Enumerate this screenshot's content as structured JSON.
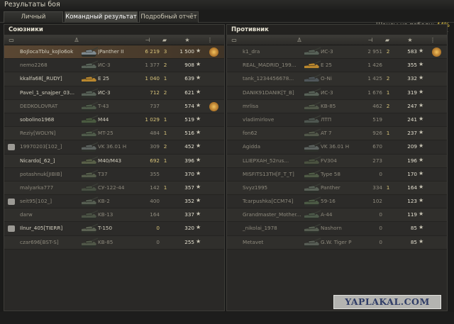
{
  "window_title": "Результаты боя",
  "tabs": [
    {
      "label": "Личный результат",
      "active": false
    },
    {
      "label": "Командный результат",
      "active": true
    },
    {
      "label": "Подробный отчёт",
      "active": false
    }
  ],
  "win_chance": {
    "label": "Шансы на победу:",
    "value": "44%"
  },
  "colors": {
    "accent": "#e2c241",
    "highlight_row": "#5a4733",
    "background": "#2a2927"
  },
  "allies": {
    "title": "Союзники",
    "players": [
      {
        "name": "BoJlocaTblu_koJlo6ok",
        "tank": "JPanther II",
        "damage": "6 219",
        "kills": "3",
        "xp": "1 500",
        "alive": true,
        "me": true,
        "medal": true,
        "badge": false,
        "tank_color": "#7f8a8f"
      },
      {
        "name": "nemo2268",
        "tank": "ИС-3",
        "damage": "1 377",
        "kills": "2",
        "xp": "908",
        "alive": false,
        "me": false,
        "medal": false,
        "badge": false,
        "tank_color": "#586258"
      },
      {
        "name": "kkalfa68[_RUDY]",
        "tank": "E 25",
        "damage": "1 040",
        "kills": "1",
        "xp": "639",
        "alive": true,
        "me": false,
        "medal": false,
        "badge": false,
        "tank_color": "#b9872e"
      },
      {
        "name": "Pavel_1_snajper_03...",
        "tank": "ИС-3",
        "damage": "712",
        "kills": "2",
        "xp": "621",
        "alive": true,
        "me": false,
        "medal": false,
        "badge": false,
        "tank_color": "#586258"
      },
      {
        "name": "DEDKOLOVRAT",
        "tank": "T-43",
        "damage": "737",
        "kills": "",
        "xp": "574",
        "alive": false,
        "me": false,
        "medal": true,
        "badge": false,
        "tank_color": "#4d5948"
      },
      {
        "name": "sobolino1968",
        "tank": "M44",
        "damage": "1 029",
        "kills": "1",
        "xp": "519",
        "alive": true,
        "me": false,
        "medal": false,
        "badge": false,
        "tank_color": "#4a5a40"
      },
      {
        "name": "Reziy[WOLYN]",
        "tank": "MT-25",
        "damage": "484",
        "kills": "1",
        "xp": "516",
        "alive": false,
        "me": false,
        "medal": false,
        "badge": false,
        "tank_color": "#4f5b4a"
      },
      {
        "name": "19970203[102_]",
        "tank": "VK 36.01 H",
        "damage": "309",
        "kills": "2",
        "xp": "452",
        "alive": false,
        "me": false,
        "medal": false,
        "badge": true,
        "tank_color": "#5d6360"
      },
      {
        "name": "Nicardo[_62_]",
        "tank": "M40/M43",
        "damage": "692",
        "kills": "1",
        "xp": "396",
        "alive": true,
        "me": false,
        "medal": false,
        "badge": false,
        "tank_color": "#596048"
      },
      {
        "name": "potashnuk[JIBIB]",
        "tank": "T37",
        "damage": "355",
        "kills": "",
        "xp": "370",
        "alive": false,
        "me": false,
        "medal": false,
        "badge": false,
        "tank_color": "#545c4a"
      },
      {
        "name": "malyarka777",
        "tank": "СУ-122-44",
        "damage": "142",
        "kills": "1",
        "xp": "357",
        "alive": false,
        "me": false,
        "medal": false,
        "badge": false,
        "tank_color": "#485042"
      },
      {
        "name": "seit95[102_]",
        "tank": "KB-2",
        "damage": "400",
        "kills": "",
        "xp": "352",
        "alive": false,
        "me": false,
        "medal": false,
        "badge": true,
        "tank_color": "#565e52"
      },
      {
        "name": "darw",
        "tank": "KB-13",
        "damage": "164",
        "kills": "",
        "xp": "337",
        "alive": false,
        "me": false,
        "medal": false,
        "badge": false,
        "tank_color": "#4c5446"
      },
      {
        "name": "Ilnur_405[TIERR]",
        "tank": "T-150",
        "damage": "0",
        "kills": "",
        "xp": "320",
        "alive": true,
        "me": false,
        "medal": false,
        "badge": true,
        "tank_color": "#5b6152"
      },
      {
        "name": "czar696[BST-S]",
        "tank": "KB-85",
        "damage": "0",
        "kills": "",
        "xp": "255",
        "alive": false,
        "me": false,
        "medal": false,
        "badge": false,
        "tank_color": "#505748"
      }
    ]
  },
  "enemies": {
    "title": "Противник",
    "players": [
      {
        "name": "k1_dra",
        "tank": "ИС-3",
        "damage": "2 951",
        "kills": "2",
        "xp": "583",
        "alive": false,
        "me": false,
        "medal": true,
        "badge": false,
        "tank_color": "#586258"
      },
      {
        "name": "REAL_MADRID_199...",
        "tank": "E 25",
        "damage": "1 426",
        "kills": "",
        "xp": "355",
        "alive": false,
        "me": false,
        "medal": false,
        "badge": false,
        "tank_color": "#b9872e"
      },
      {
        "name": "tank_1234456678...",
        "tank": "O-Ni",
        "damage": "1 425",
        "kills": "2",
        "xp": "332",
        "alive": false,
        "me": false,
        "medal": false,
        "badge": false,
        "tank_color": "#4f565a"
      },
      {
        "name": "DANIK91DANIK[T_B]",
        "tank": "ИС-3",
        "damage": "1 676",
        "kills": "1",
        "xp": "319",
        "alive": false,
        "me": false,
        "medal": false,
        "badge": false,
        "tank_color": "#586258"
      },
      {
        "name": "mrlisa",
        "tank": "KB-85",
        "damage": "462",
        "kills": "2",
        "xp": "247",
        "alive": false,
        "me": false,
        "medal": false,
        "badge": false,
        "tank_color": "#505748"
      },
      {
        "name": "vladimirlove",
        "tank": "ЛТП",
        "damage": "519",
        "kills": "",
        "xp": "241",
        "alive": false,
        "me": false,
        "medal": false,
        "badge": false,
        "tank_color": "#4e5650"
      },
      {
        "name": "fon62",
        "tank": "AT 7",
        "damage": "926",
        "kills": "1",
        "xp": "237",
        "alive": false,
        "me": false,
        "medal": false,
        "badge": false,
        "tank_color": "#515749"
      },
      {
        "name": "Agidda",
        "tank": "VK 36.01 H",
        "damage": "670",
        "kills": "",
        "xp": "209",
        "alive": false,
        "me": false,
        "medal": false,
        "badge": false,
        "tank_color": "#5d6360"
      },
      {
        "name": "LLIEPXAH_52rus...",
        "tank": "FV304",
        "damage": "273",
        "kills": "",
        "xp": "196",
        "alive": false,
        "me": false,
        "medal": false,
        "badge": false,
        "tank_color": "#4a5240"
      },
      {
        "name": "MISFITS13TH[F_T_T]",
        "tank": "Type 58",
        "damage": "0",
        "kills": "",
        "xp": "170",
        "alive": false,
        "me": false,
        "medal": false,
        "badge": false,
        "tank_color": "#4f5b46"
      },
      {
        "name": "Svyz1995",
        "tank": "Panther",
        "damage": "334",
        "kills": "1",
        "xp": "164",
        "alive": false,
        "me": false,
        "medal": false,
        "badge": false,
        "tank_color": "#596157"
      },
      {
        "name": "Tcarpushka[CCM74]",
        "tank": "59-16",
        "damage": "102",
        "kills": "",
        "xp": "123",
        "alive": false,
        "me": false,
        "medal": false,
        "badge": false,
        "tank_color": "#4c5a45"
      },
      {
        "name": "Grandmaster_Mother...",
        "tank": "A-44",
        "damage": "0",
        "kills": "",
        "xp": "119",
        "alive": false,
        "me": false,
        "medal": false,
        "badge": false,
        "tank_color": "#4d5a4a"
      },
      {
        "name": "_nikolai_1978",
        "tank": "Nashorn",
        "damage": "0",
        "kills": "",
        "xp": "85",
        "alive": false,
        "me": false,
        "medal": false,
        "badge": false,
        "tank_color": "#555c50"
      },
      {
        "name": "Metavet",
        "tank": "G.W. Tiger P",
        "damage": "0",
        "kills": "",
        "xp": "85",
        "alive": false,
        "me": false,
        "medal": false,
        "badge": false,
        "tank_color": "#575d55"
      }
    ]
  },
  "columns": [
    "squad-icon",
    "player-icon",
    "damage-icon",
    "kills-icon",
    "xp-icon",
    "achievements-icon"
  ],
  "watermark": "YAPLAKAL.COM"
}
